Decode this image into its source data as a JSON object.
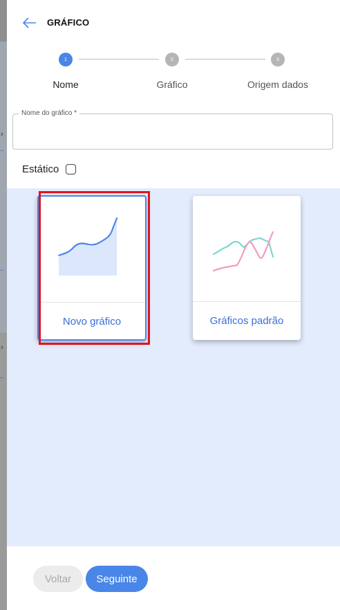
{
  "header": {
    "title": "GRÁFICO",
    "back_icon": "arrow-left-icon"
  },
  "stepper": {
    "steps": [
      {
        "number": "1",
        "label": "Nome",
        "state": "active"
      },
      {
        "number": "2",
        "label": "Gráfico",
        "state": "inactive"
      },
      {
        "number": "3",
        "label": "Origem dados",
        "state": "inactive"
      }
    ]
  },
  "name_field": {
    "label": "Nome do gráfico *",
    "value": "",
    "placeholder": ""
  },
  "static": {
    "label": "Estático",
    "checked": false
  },
  "cards": [
    {
      "label": "Novo gráfico",
      "selected": true,
      "icon": "area-chart-icon"
    },
    {
      "label": "Gráficos padrão",
      "selected": false,
      "icon": "line-chart-icon"
    }
  ],
  "footer": {
    "back_label": "Voltar",
    "next_label": "Seguinte"
  },
  "colors": {
    "accent": "#4a86e8",
    "cards_background": "#e3ecfc",
    "selection_outline": "#e0141e",
    "line_pink": "#f29ac0",
    "line_teal": "#7fd6cf"
  }
}
